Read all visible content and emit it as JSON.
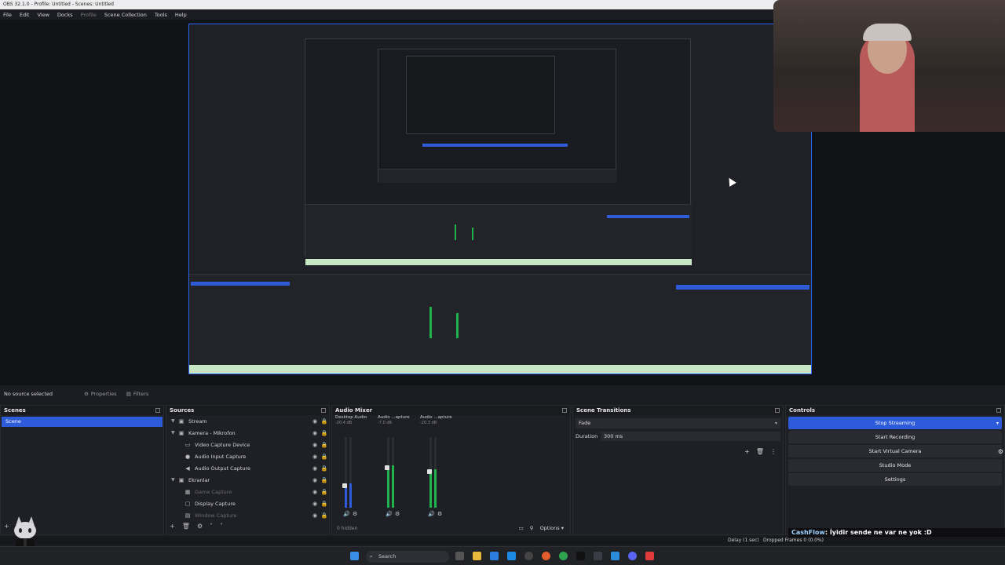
{
  "window": {
    "title": "OBS 32.1.0 - Profile: Untitled - Scenes: Untitled"
  },
  "menu": [
    "File",
    "Edit",
    "View",
    "Docks",
    "Profile",
    "Scene Collection",
    "Tools",
    "Help"
  ],
  "source_toolbar": {
    "no_source": "No source selected",
    "properties": "Properties",
    "filters": "Filters"
  },
  "scenes": {
    "title": "Scenes",
    "items": [
      "Scene"
    ]
  },
  "sources": {
    "title": "Sources",
    "items": [
      {
        "name": "Stream",
        "icon": "folder-icon",
        "dim": false,
        "indent": 1
      },
      {
        "name": "Kamera - Mikrofon",
        "icon": "folder-icon",
        "dim": false,
        "indent": 1
      },
      {
        "name": "Video Capture Device",
        "icon": "camera-icon",
        "dim": false,
        "indent": 2
      },
      {
        "name": "Audio Input Capture",
        "icon": "mic-icon",
        "dim": false,
        "indent": 2
      },
      {
        "name": "Audio Output Capture",
        "icon": "speaker-icon",
        "dim": false,
        "indent": 2
      },
      {
        "name": "Ekranlar",
        "icon": "folder-icon",
        "dim": false,
        "indent": 1
      },
      {
        "name": "Game Capture",
        "icon": "gamepad-icon",
        "dim": true,
        "indent": 2
      },
      {
        "name": "Display Capture",
        "icon": "monitor-icon",
        "dim": false,
        "indent": 2
      },
      {
        "name": "Window Capture",
        "icon": "window-icon",
        "dim": true,
        "indent": 2
      }
    ]
  },
  "mixer": {
    "title": "Audio Mixer",
    "channels": [
      {
        "name": "Desktop Audio",
        "db": "-20.4 dB",
        "level": 0.35,
        "color": "#2d5bd9"
      },
      {
        "name": "Audio ...apture",
        "db": "-7.0 dB",
        "level": 0.6,
        "color": "#1fb34a"
      },
      {
        "name": "Audio ...apture",
        "db": "-20.3 dB",
        "level": 0.55,
        "color": "#1fb34a"
      }
    ],
    "hidden": "0 hidden",
    "options": "Options"
  },
  "transitions": {
    "title": "Scene Transitions",
    "current": "Fade",
    "duration_label": "Duration",
    "duration": "300 ms"
  },
  "controls": {
    "title": "Controls",
    "buttons": [
      "Stop Streaming",
      "Start Recording",
      "Start Virtual Camera",
      "Studio Mode",
      "Settings"
    ]
  },
  "chat": {
    "user": "CashFlow",
    "message": "İyidir sende ne var ne yok :D"
  },
  "status": {
    "delay": "Delay (1 sec)",
    "dropped": "Dropped Frames 0 (0.0%)"
  },
  "taskbar": {
    "search": "Search"
  },
  "colors": {
    "accent": "#2d5bd9",
    "meter_green": "#1fb34a",
    "preview_border": "#2d66ff"
  }
}
